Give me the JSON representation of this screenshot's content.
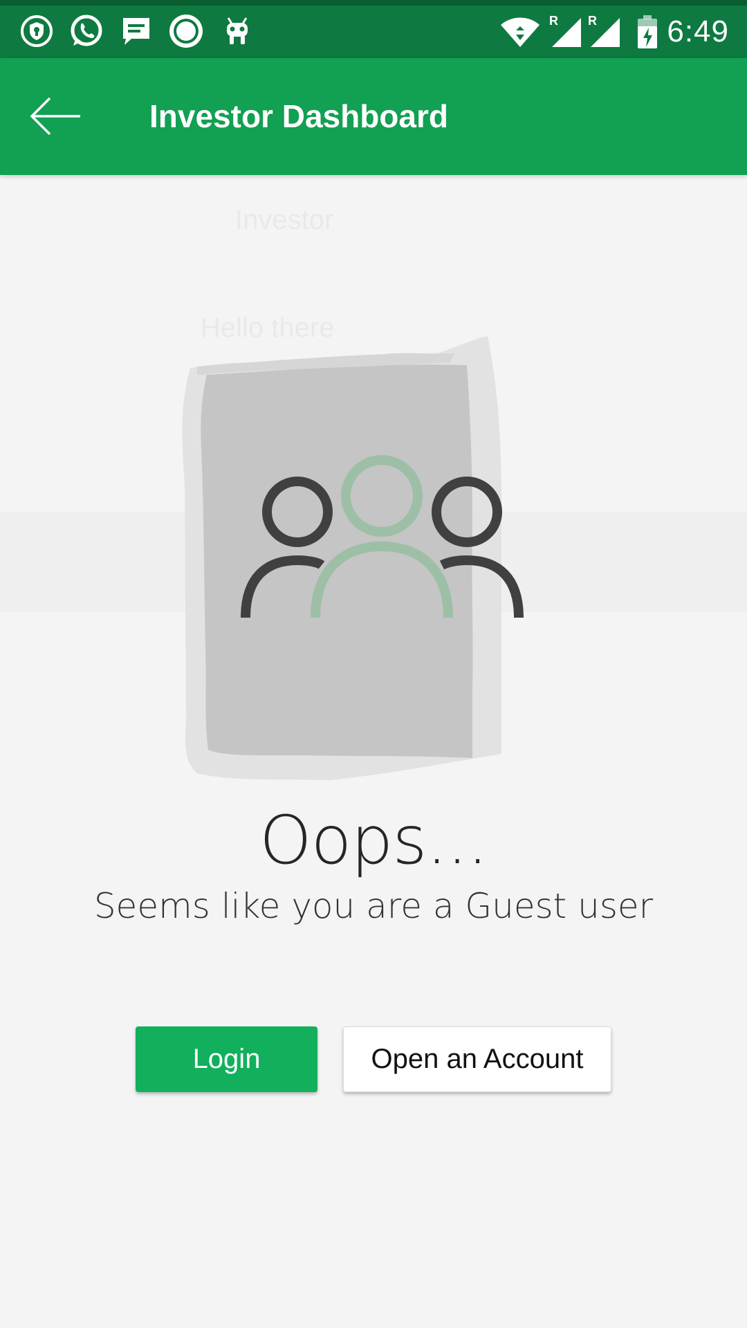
{
  "status_bar": {
    "time": "6:49",
    "icons": [
      "shield-icon",
      "whatsapp-icon",
      "message-icon",
      "circle-app-icon",
      "android-icon",
      "wifi-icon",
      "signal-icon",
      "signal-icon",
      "battery-charging-icon"
    ]
  },
  "app_bar": {
    "title": "Investor Dashboard",
    "back_icon": "back-arrow-icon"
  },
  "faded_background": {
    "line1": "Investor",
    "line2": "Hello there"
  },
  "message": {
    "title": "Oops...",
    "subtitle": "Seems like you are a Guest user"
  },
  "actions": {
    "login_label": "Login",
    "open_account_label": "Open an Account"
  },
  "colors": {
    "status_bar": "#0e7a41",
    "app_bar": "#12a052",
    "login_button": "#12b05c",
    "background": "#f4f4f4"
  }
}
